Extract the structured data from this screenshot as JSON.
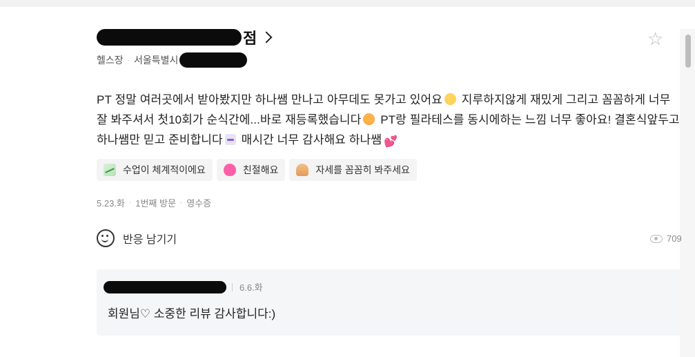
{
  "place": {
    "name_suffix": "점",
    "category": "헬스장",
    "address_prefix": "서울특별시"
  },
  "review": {
    "part1": "PT 정말 여러곳에서 받아봤지만 하나쌤 만나고 아무데도 못가고 있어요",
    "part2": " 지루하지않게 재밌게 그리고 꼼꼼하게 너무 잘 봐주셔서 첫10회가 순식간에...바로 재등록했습니다",
    "part3": " PT랑 필라테스를 동시에하는 느낌 너무 좋아요! 결혼식앞두고 하나쌤만 믿고 준비합니다",
    "part4": " 매시간 너무 감사해요 하나쌤"
  },
  "tags": [
    {
      "icon": "chart-up-icon",
      "label": "수업이 체계적이에요"
    },
    {
      "icon": "heart-icon",
      "label": "친절해요"
    },
    {
      "icon": "person-icon",
      "label": "자세를 꼼꼼히 봐주세요"
    }
  ],
  "meta": {
    "date": "5.23.화",
    "visit": "1번째 방문",
    "receipt": "영수증"
  },
  "reaction": {
    "label": "반응 남기기",
    "views": "709"
  },
  "owner_reply": {
    "date": "6.6.화",
    "message": "회원님♡ 소중한 리뷰 감사합니다:)"
  }
}
